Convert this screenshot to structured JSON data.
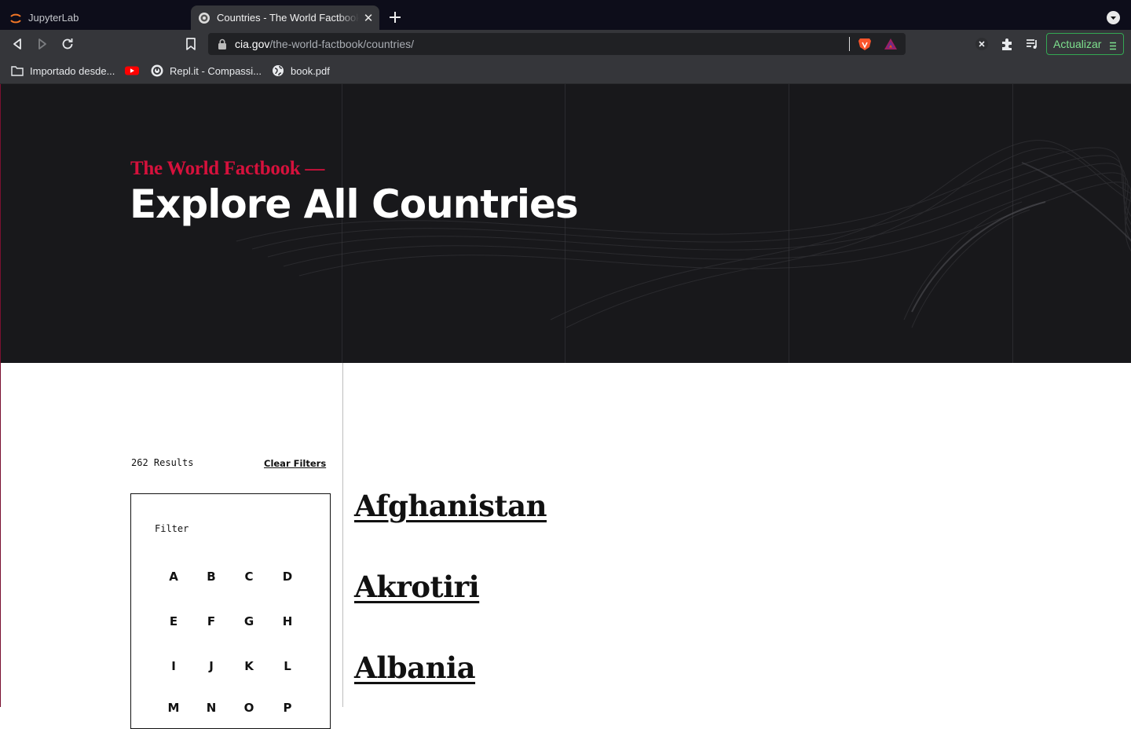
{
  "browser": {
    "tabs": [
      {
        "title": "JupyterLab",
        "active": false
      },
      {
        "title": "Countries - The World Factbook",
        "active": true
      }
    ],
    "url_host": "cia.gov",
    "url_path": "/the-world-factbook/countries/",
    "update_button": "Actualizar",
    "bookmarks": [
      "Importado desde...",
      "Repl.it - Compassi...",
      "book.pdf"
    ],
    "icons": [
      "back-icon",
      "forward-icon",
      "reload-icon",
      "bookmark-icon",
      "lock-icon",
      "brave-shield-icon",
      "bat-rewards-icon",
      "extensions-icon",
      "playlist-icon"
    ]
  },
  "hero": {
    "eyebrow": "The World Factbook —",
    "title": "Explore All Countries"
  },
  "sidebar": {
    "results": "262 Results",
    "clear_filters": "Clear Filters",
    "filter_label": "Filter",
    "letters": [
      "A",
      "B",
      "C",
      "D",
      "E",
      "F",
      "G",
      "H",
      "I",
      "J",
      "K",
      "L",
      "M",
      "N",
      "O",
      "P"
    ]
  },
  "countries": [
    "Afghanistan",
    "Akrotiri",
    "Albania"
  ],
  "colors": {
    "accent_red": "#d6113c",
    "hero_bg": "#18181b",
    "update_green": "#34a853"
  }
}
